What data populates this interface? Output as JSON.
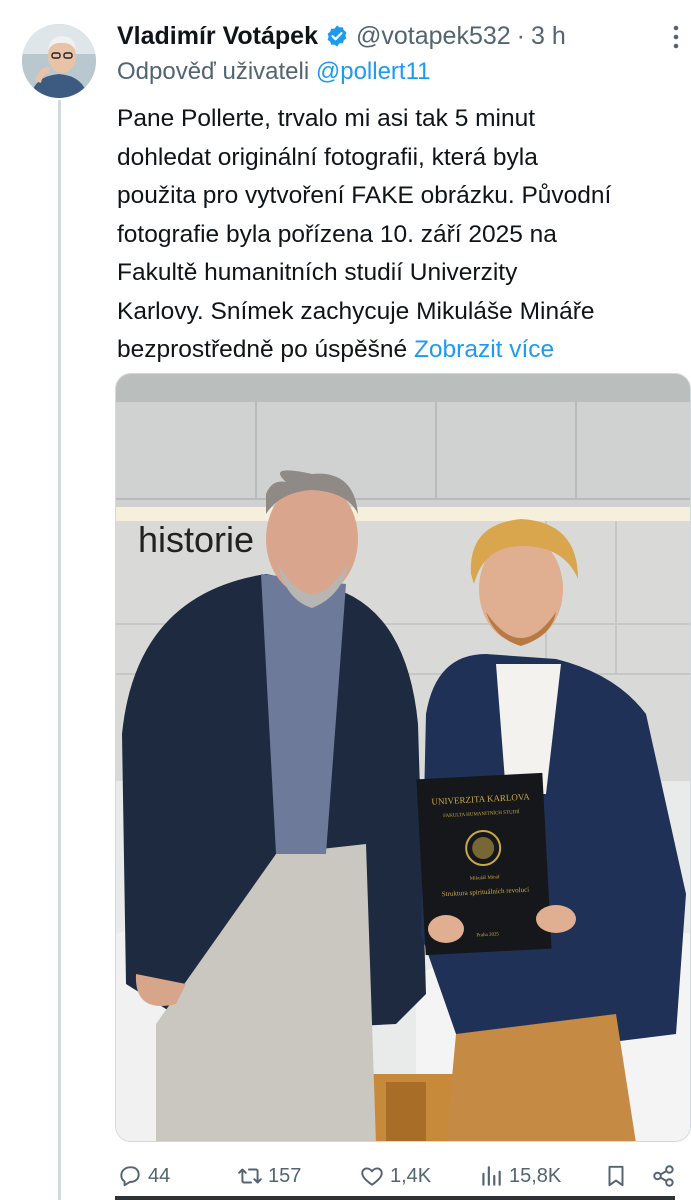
{
  "tweet": {
    "author_name": "Vladimír Votápek",
    "handle": "@votapek532",
    "separator": "·",
    "time": "3 h",
    "reply_prefix": "Odpověď uživateli",
    "reply_mention": "@pollert11",
    "text_lines": [
      "Pane Pollerte, trvalo mi asi tak 5 minut",
      "dohledat originální fotografii, která byla",
      "použita pro vytvoření FAKE obrázku. Původní",
      "fotografie byla pořízena 10. září 2025 na",
      "Fakultě humanitních studií Univerzity",
      "Karlovy. Snímek zachycuje Mikuláše Mináře",
      "bezprostředně po úspěšné"
    ],
    "show_more": "Zobrazit více",
    "verified": true
  },
  "media": {
    "wall_sign": "historie",
    "book": {
      "university": "UNIVERZITA KARLOVA",
      "faculty": "FAKULTA HUMANITNÍCH STUDIÍ",
      "author": "Mikuláš Minář",
      "title": "Struktura spirituálních revolucí",
      "city_year": "Praha 2025"
    }
  },
  "actions": {
    "replies": "44",
    "reposts": "157",
    "likes": "1,4K",
    "views": "15,8K"
  },
  "colors": {
    "accent": "#1d9bf0",
    "muted": "#536471",
    "text": "#0f1419"
  }
}
